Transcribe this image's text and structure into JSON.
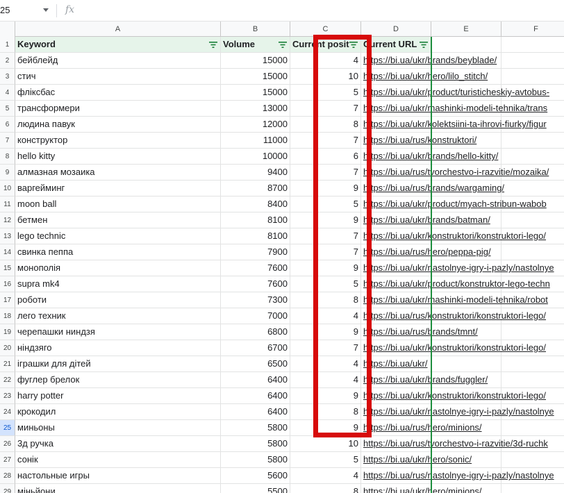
{
  "formula_bar": {
    "name_box": "25",
    "fx_label": "fx"
  },
  "columns": [
    "A",
    "B",
    "C",
    "D",
    "E",
    "F"
  ],
  "header": {
    "keyword": "Keyword",
    "volume": "Volume",
    "position": "Current posit",
    "url": "Current URL"
  },
  "rows": [
    {
      "n": "2",
      "keyword": "бейблейд",
      "volume": "15000",
      "position": "4",
      "url": "https://bi.ua/ukr/brands/beyblade/"
    },
    {
      "n": "3",
      "keyword": "стич",
      "volume": "15000",
      "position": "10",
      "url": "https://bi.ua/ukr/hero/lilo_stitch/"
    },
    {
      "n": "4",
      "keyword": "фліксбас",
      "volume": "15000",
      "position": "5",
      "url": "https://bi.ua/ukr/product/turisticheskiy-avtobus-"
    },
    {
      "n": "5",
      "keyword": "трансформери",
      "volume": "13000",
      "position": "7",
      "url": "https://bi.ua/ukr/mashinki-modeli-tehnika/trans"
    },
    {
      "n": "6",
      "keyword": "людина павук",
      "volume": "12000",
      "position": "8",
      "url": "https://bi.ua/ukr/kolektsiini-ta-ihrovi-fiurky/figur"
    },
    {
      "n": "7",
      "keyword": "конструктор",
      "volume": "11000",
      "position": "7",
      "url": "https://bi.ua/rus/konstruktori/"
    },
    {
      "n": "8",
      "keyword": "hello kitty",
      "volume": "10000",
      "position": "6",
      "url": "https://bi.ua/ukr/brands/hello-kitty/"
    },
    {
      "n": "9",
      "keyword": "алмазная мозаика",
      "volume": "9400",
      "position": "7",
      "url": "https://bi.ua/rus/tvorchestvo-i-razvitie/mozaika/"
    },
    {
      "n": "10",
      "keyword": "варгейминг",
      "volume": "8700",
      "position": "9",
      "url": "https://bi.ua/rus/brands/wargaming/"
    },
    {
      "n": "11",
      "keyword": "moon ball",
      "volume": "8400",
      "position": "5",
      "url": "https://bi.ua/ukr/product/myach-stribun-wabob"
    },
    {
      "n": "12",
      "keyword": "бетмен",
      "volume": "8100",
      "position": "9",
      "url": "https://bi.ua/ukr/brands/batman/"
    },
    {
      "n": "13",
      "keyword": "lego technic",
      "volume": "8100",
      "position": "7",
      "url": "https://bi.ua/ukr/konstruktori/konstruktori-lego/"
    },
    {
      "n": "14",
      "keyword": "свинка пеппа",
      "volume": "7900",
      "position": "7",
      "url": "https://bi.ua/rus/hero/peppa-pig/"
    },
    {
      "n": "15",
      "keyword": "монополія",
      "volume": "7600",
      "position": "9",
      "url": "https://bi.ua/ukr/nastolnye-igry-i-pazly/nastolnye"
    },
    {
      "n": "16",
      "keyword": "supra mk4",
      "volume": "7600",
      "position": "5",
      "url": "https://bi.ua/ukr/product/konstruktor-lego-techn"
    },
    {
      "n": "17",
      "keyword": "роботи",
      "volume": "7300",
      "position": "8",
      "url": "https://bi.ua/ukr/mashinki-modeli-tehnika/robot"
    },
    {
      "n": "18",
      "keyword": "лего техник",
      "volume": "7000",
      "position": "4",
      "url": "https://bi.ua/rus/konstruktori/konstruktori-lego/"
    },
    {
      "n": "19",
      "keyword": "черепашки ниндзя",
      "volume": "6800",
      "position": "9",
      "url": "https://bi.ua/rus/brands/tmnt/"
    },
    {
      "n": "20",
      "keyword": "ніндзяго",
      "volume": "6700",
      "position": "7",
      "url": "https://bi.ua/ukr/konstruktori/konstruktori-lego/"
    },
    {
      "n": "21",
      "keyword": "іграшки для дітей",
      "volume": "6500",
      "position": "4",
      "url": "https://bi.ua/ukr/"
    },
    {
      "n": "22",
      "keyword": "фуглер брелок",
      "volume": "6400",
      "position": "4",
      "url": "https://bi.ua/ukr/brands/fuggler/"
    },
    {
      "n": "23",
      "keyword": "harry potter",
      "volume": "6400",
      "position": "9",
      "url": "https://bi.ua/ukr/konstruktori/konstruktori-lego/"
    },
    {
      "n": "24",
      "keyword": "крокодил",
      "volume": "6400",
      "position": "8",
      "url": "https://bi.ua/ukr/nastolnye-igry-i-pazly/nastolnye"
    },
    {
      "n": "25",
      "keyword": "миньоны",
      "volume": "5800",
      "position": "9",
      "url": "https://bi.ua/rus/hero/minions/"
    },
    {
      "n": "26",
      "keyword": "3д ручка",
      "volume": "5800",
      "position": "10",
      "url": "https://bi.ua/rus/tvorchestvo-i-razvitie/3d-ruchk"
    },
    {
      "n": "27",
      "keyword": "сонік",
      "volume": "5800",
      "position": "5",
      "url": "https://bi.ua/ukr/hero/sonic/"
    },
    {
      "n": "28",
      "keyword": "настольные игры",
      "volume": "5600",
      "position": "4",
      "url": "https://bi.ua/rus/nastolnye-igry-i-pazly/nastolnye"
    },
    {
      "n": "29",
      "keyword": "міньйони",
      "volume": "5500",
      "position": "8",
      "url": "https://bi.ua/ukr/hero/minions/"
    }
  ],
  "colors": {
    "highlight": "#d70a0a",
    "freeze_line": "#1e8e3e"
  }
}
